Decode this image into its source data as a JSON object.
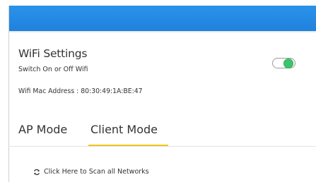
{
  "settings": {
    "title": "WiFi Settings",
    "subtitle": "Switch On or Off Wifi",
    "wifi_enabled": true,
    "mac_label": "Wifi Mac Address : 80:30:49:1A:BE:47"
  },
  "tabs": [
    {
      "label": "AP Mode",
      "active": false
    },
    {
      "label": "Client Mode",
      "active": true
    }
  ],
  "scan": {
    "icon": "refresh-icon",
    "label": "Click Here to Scan all Networks"
  },
  "colors": {
    "header": "#2189e4",
    "toggle_on": "#3cc46b",
    "tab_active_underline": "#f2c31a"
  }
}
